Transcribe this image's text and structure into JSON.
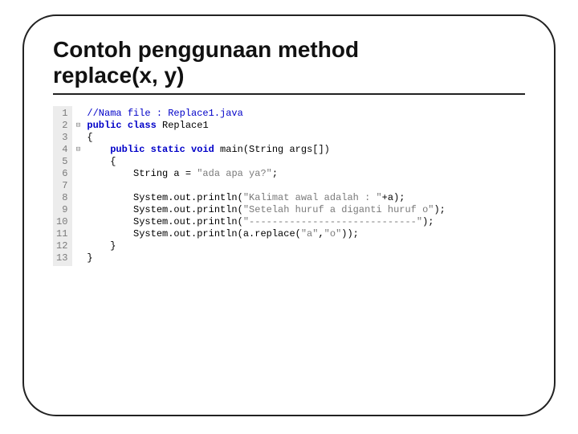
{
  "title_line1": "Contoh penggunaan method",
  "title_line2": "replace(x, y)",
  "gutter": " 1\n 2\n 3\n 4\n 5\n 6\n 7\n 8\n 9\n10\n11\n12\n13",
  "fold": " \n⊟\n \n⊟\n \n \n \n \n \n \n \n \n ",
  "code": {
    "l1_comment": "//Nama file : Replace1.java",
    "l2_kw": "public class",
    "l2_rest": " Replace1",
    "l3": "{",
    "l4_pad": "    ",
    "l4_kw": "public static void",
    "l4_rest": " main(String args[])",
    "l5": "    {",
    "l6a": "        String a = ",
    "l6s": "\"ada apa ya?\"",
    "l6b": ";",
    "l7": "",
    "l8a": "        System.out.println(",
    "l8s": "\"Kalimat awal adalah : \"",
    "l8b": "+a);",
    "l9a": "        System.out.println(",
    "l9s": "\"Setelah huruf a diganti huruf o\"",
    "l9b": ");",
    "l10a": "        System.out.println(",
    "l10s": "\"-----------------------------\"",
    "l10b": ");",
    "l11a": "        System.out.println(a.replace(",
    "l11s1": "\"a\"",
    "l11m": ",",
    "l11s2": "\"o\"",
    "l11b": "));",
    "l12": "    }",
    "l13": "}"
  }
}
